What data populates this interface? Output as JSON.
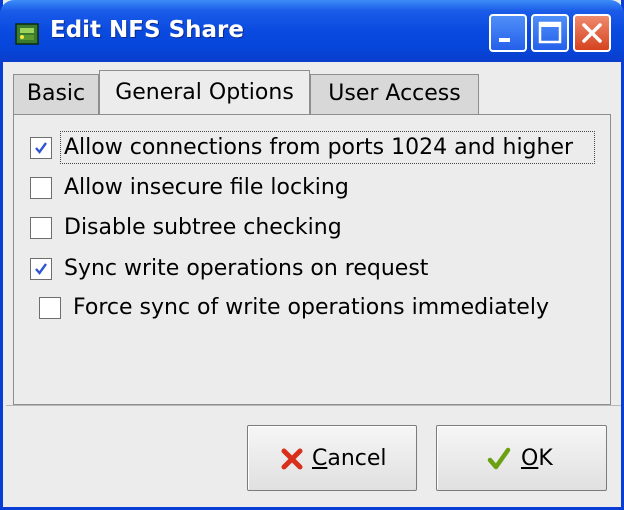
{
  "window": {
    "title": "Edit NFS Share",
    "accent": "#0a4ae0",
    "close_color": "#d5431f"
  },
  "tabs": [
    {
      "label": "Basic",
      "active": false
    },
    {
      "label": "General Options",
      "active": true
    },
    {
      "label": "User Access",
      "active": false
    }
  ],
  "options": [
    {
      "label": "Allow connections from ports 1024 and higher",
      "checked": true
    },
    {
      "label": "Allow insecure file locking",
      "checked": false
    },
    {
      "label": "Disable subtree checking",
      "checked": false
    },
    {
      "label": "Sync write operations on request",
      "checked": true
    },
    {
      "label": "Force sync of write operations immediately",
      "checked": false
    }
  ],
  "buttons": {
    "cancel": {
      "mnemonic": "C",
      "rest": "ancel",
      "icon": "x-icon",
      "icon_color": "#d9301b"
    },
    "ok": {
      "mnemonic": "O",
      "rest": "K",
      "icon": "check-icon",
      "icon_color": "#6aa012"
    }
  },
  "check_color": "#2f55d4"
}
